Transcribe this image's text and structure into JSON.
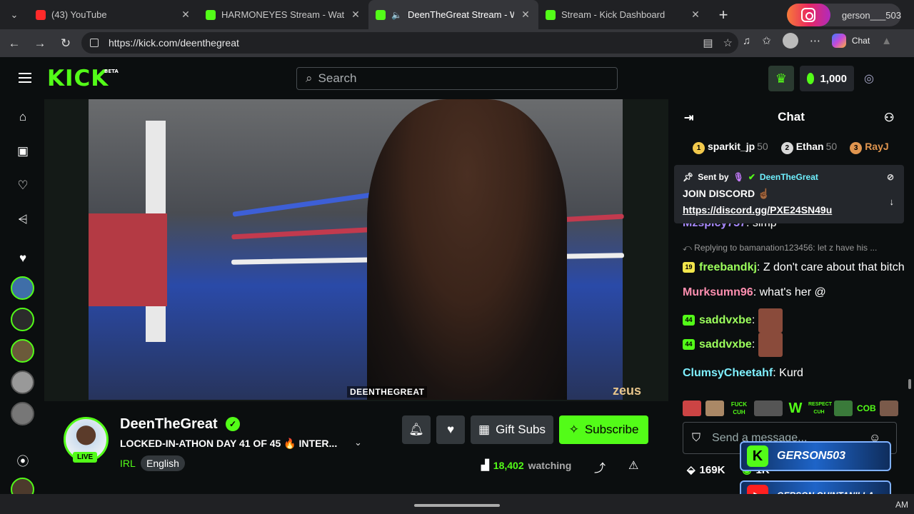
{
  "browser": {
    "tabs": [
      {
        "title": "(43) YouTube",
        "favicon": "youtube-icon",
        "active": false
      },
      {
        "title": "HARMONEYES Stream - Watch Live",
        "favicon": "kick-icon",
        "active": false
      },
      {
        "title": "DeenTheGreat Stream - Watch",
        "favicon": "kick-icon",
        "active": true
      },
      {
        "title": "Stream - Kick Dashboard",
        "favicon": "kick-icon",
        "active": false
      }
    ],
    "url": "https://kick.com/deenthegreat",
    "profile_name": "gerson___503",
    "copilot_label": "Chat"
  },
  "header": {
    "logo": "KICK",
    "logo_badge": "BETA",
    "search_placeholder": "Search",
    "points": "1,000"
  },
  "stream": {
    "video_tag": "DEENTHEGREAT",
    "video_watermark": "zeus",
    "channel_name": "DeenTheGreat",
    "live_label": "LIVE",
    "title": "LOCKED-IN-ATHON DAY 41 OF 45 🔥 INTER...",
    "category": "IRL",
    "language": "English",
    "gift_label": "Gift Subs",
    "subscribe_label": "Subscribe",
    "viewers": "18,402",
    "viewers_suffix": "watching"
  },
  "chat": {
    "title": "Chat",
    "leaderboard": [
      {
        "rank": "1",
        "user": "sparkit_jp",
        "points": "50",
        "color": "#f2c94c"
      },
      {
        "rank": "2",
        "user": "Ethan",
        "points": "50",
        "color": "#d8d8d8"
      },
      {
        "rank": "3",
        "user": "RayJ",
        "points": "",
        "color": "#e0954f"
      }
    ],
    "pinned": {
      "sent_by_label": "Sent by",
      "sender": "DeenTheGreat",
      "message": "JOIN DISCORD ☝🏾",
      "link": "https://discord.gg/PXE24SN49u"
    },
    "partial_message": {
      "user": "Mzspicy757",
      "text": ": simp"
    },
    "reply_context": "Replying to bamanation123456: let z have his ...",
    "messages": [
      {
        "badge": "19",
        "badge_color": "#f2e64c",
        "user": "freebandkj",
        "user_color": "#9cff5c",
        "text": ": Z don't care about that bitch"
      },
      {
        "badge": "",
        "badge_color": "",
        "user": "Murksumn96",
        "user_color": "#ff8fb0",
        "text": ": what's her @"
      },
      {
        "badge": "44",
        "badge_color": "#53fc18",
        "user": "saddvxbe",
        "user_color": "#9cff5c",
        "text": ":"
      },
      {
        "badge": "44",
        "badge_color": "#53fc18",
        "user": "saddvxbe",
        "user_color": "#9cff5c",
        "text": ":"
      },
      {
        "badge": "",
        "badge_color": "",
        "user": "ClumsyCheetahf",
        "user_color": "#7ff0ff",
        "text": ": Kurd"
      }
    ],
    "emote_texts": [
      "FUCK CUH",
      "W",
      "RESPECT CUH",
      "COB"
    ],
    "input_placeholder": "Send a message...",
    "footer_points": "169K",
    "footer_count": "1K"
  },
  "overlays": {
    "kick_name": "GERSON503",
    "youtube_name": "GERSON QUINTANILLA"
  },
  "taskbar": {
    "clock": "AM"
  }
}
